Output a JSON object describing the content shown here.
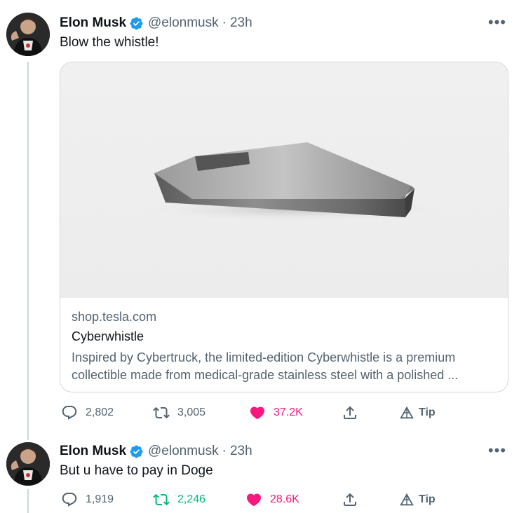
{
  "tweets": [
    {
      "author": {
        "name": "Elon Musk",
        "handle": "@elonmusk",
        "avatar": "profile-photo"
      },
      "time": "23h",
      "separator": "·",
      "text": "Blow the whistle!",
      "card": {
        "domain": "shop.tesla.com",
        "title": "Cyberwhistle",
        "description": "Inspired by Cybertruck, the limited-edition Cyberwhistle is a premium collectible made from medical-grade stainless steel with a polished ...",
        "image": "cyberwhistle-product-photo"
      },
      "actions": {
        "replies": "2,802",
        "retweets": "3,005",
        "likes": "37.2K",
        "tip": "Tip"
      },
      "liked": true,
      "retweeted": false
    },
    {
      "author": {
        "name": "Elon Musk",
        "handle": "@elonmusk",
        "avatar": "profile-photo"
      },
      "time": "23h",
      "separator": "·",
      "text": "But u have to pay in Doge",
      "actions": {
        "replies": "1,919",
        "retweets": "2,246",
        "likes": "28.6K",
        "tip": "Tip"
      },
      "liked": true,
      "retweeted": true
    }
  ],
  "colors": {
    "like": "#f91880",
    "retweet": "#00ba7c",
    "verified": "#1d9bf0",
    "secondary": "#536471"
  },
  "icons": [
    "more-icon",
    "verified-icon",
    "reply-icon",
    "retweet-icon",
    "heart-icon",
    "share-icon",
    "tip-icon"
  ]
}
